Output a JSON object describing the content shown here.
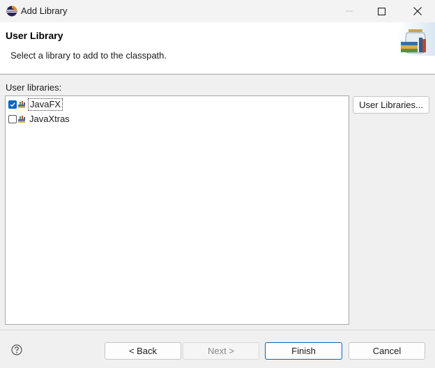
{
  "window": {
    "title": "Add Library",
    "icon": "eclipse-icon"
  },
  "header": {
    "title": "User Library",
    "description": "Select a library to add to the classpath.",
    "banner_icon": "library-jar-icon"
  },
  "list": {
    "label": "User libraries:",
    "items": [
      {
        "label": "JavaFX",
        "checked": true,
        "icon": "library-icon"
      },
      {
        "label": "JavaXtras",
        "checked": false,
        "icon": "library-icon"
      }
    ]
  },
  "buttons": {
    "user_libraries": "User Libraries...",
    "back": "< Back",
    "next": "Next >",
    "finish": "Finish",
    "cancel": "Cancel"
  },
  "colors": {
    "accent": "#0067c0",
    "checkbox_checked": "#0067c0"
  }
}
